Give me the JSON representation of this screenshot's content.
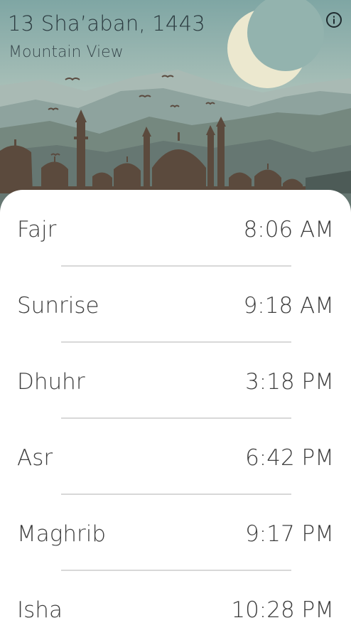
{
  "header": {
    "date": "13 Sha’aban, 1443",
    "location": "Mountain View",
    "info_icon": "info-icon"
  },
  "prayers": [
    {
      "name": "Fajr",
      "time": "8:06 AM"
    },
    {
      "name": "Sunrise",
      "time": "9:18 AM"
    },
    {
      "name": "Dhuhr",
      "time": "3:18 PM"
    },
    {
      "name": "Asr",
      "time": "6:42 PM"
    },
    {
      "name": "Maghrib",
      "time": "9:17 PM"
    },
    {
      "name": "Isha",
      "time": "10:28 PM"
    }
  ],
  "colors": {
    "sky_top": "#8fb2ae",
    "sky_bottom": "#c9d3c7",
    "mountain_far": "#9fb2ad",
    "mountain_mid": "#7f9590",
    "mountain_near": "#5e6f6b",
    "silhouette": "#5c4a3e",
    "moon": "#ece8cf"
  }
}
